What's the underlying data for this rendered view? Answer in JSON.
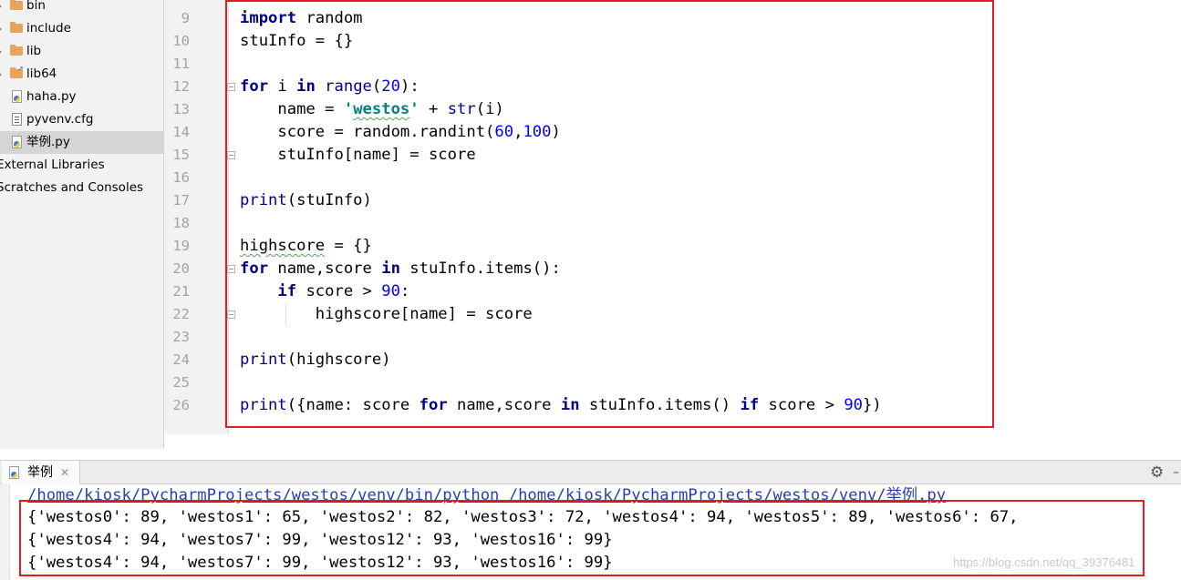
{
  "project_tree": {
    "items": [
      {
        "label": "bin",
        "icon": "folder-icon"
      },
      {
        "label": "include",
        "icon": "folder-icon"
      },
      {
        "label": "lib",
        "icon": "folder-icon"
      },
      {
        "label": "lib64",
        "icon": "folder-link-icon"
      },
      {
        "label": "haha.py",
        "icon": "python-file-icon"
      },
      {
        "label": "pyvenv.cfg",
        "icon": "config-file-icon"
      },
      {
        "label": "举例.py",
        "icon": "python-file-icon"
      },
      {
        "label": "External Libraries",
        "icon": "library-icon"
      },
      {
        "label": "Scratches and Consoles",
        "icon": "scratch-icon"
      }
    ]
  },
  "editor": {
    "line_numbers": [
      "9",
      "10",
      "11",
      "12",
      "13",
      "14",
      "15",
      "16",
      "17",
      "18",
      "19",
      "20",
      "21",
      "22",
      "23",
      "24",
      "25",
      "26"
    ]
  },
  "run_panel": {
    "tab_label": "举例",
    "command_line": "/home/kiosk/PycharmProjects/westos/venv/bin/python /home/kiosk/PycharmProjects/westos/venv/举例.py",
    "output_lines": [
      "{'westos0': 89, 'westos1': 65, 'westos2': 82, 'westos3': 72, 'westos4': 94, 'westos5': 89, 'westos6': 67,",
      "{'westos4': 94, 'westos7': 99, 'westos12': 93, 'westos16': 99}",
      "{'westos4': 94, 'westos7': 99, 'westos12': 93, 'westos16': 99}"
    ]
  },
  "watermark": "https://blog.csdn.net/qq_39376481",
  "colors": {
    "highlight_box": "#e51c24",
    "keyword": "#000080",
    "number": "#0000ff",
    "string": "#008080"
  }
}
